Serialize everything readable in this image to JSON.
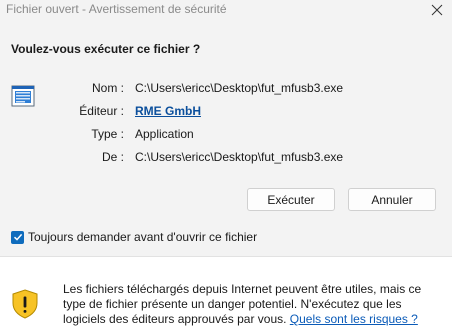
{
  "window": {
    "title": "Fichier ouvert - Avertissement de sécurité"
  },
  "dialog": {
    "question": "Voulez-vous exécuter ce fichier ?",
    "fields": [
      {
        "label": "Nom :",
        "value": "C:\\Users\\ericc\\Desktop\\fut_mfusb3.exe"
      },
      {
        "label": "Éditeur :",
        "value": "RME GmbH"
      },
      {
        "label": "Type :",
        "value": "Application"
      },
      {
        "label": "De :",
        "value": "C:\\Users\\ericc\\Desktop\\fut_mfusb3.exe"
      }
    ],
    "run_label": "Exécuter",
    "cancel_label": "Annuler",
    "checkbox_label": "Toujours demander avant d'ouvrir ce fichier",
    "checkbox_checked": true
  },
  "footer": {
    "text": "Les fichiers téléchargés depuis Internet peuvent être utiles, mais ce type de fichier présente un danger potentiel. N'exécutez que les logiciels des éditeurs approuvés par vous. ",
    "link": "Quels sont les risques ?"
  },
  "icons": {
    "close": "close-icon",
    "file": "application-file-icon",
    "checkbox": "checkmark-icon",
    "warning": "shield-warning-icon"
  },
  "colors": {
    "accent": "#0f6cbd",
    "warning": "#f7c325",
    "link": "#0b4f9c"
  }
}
